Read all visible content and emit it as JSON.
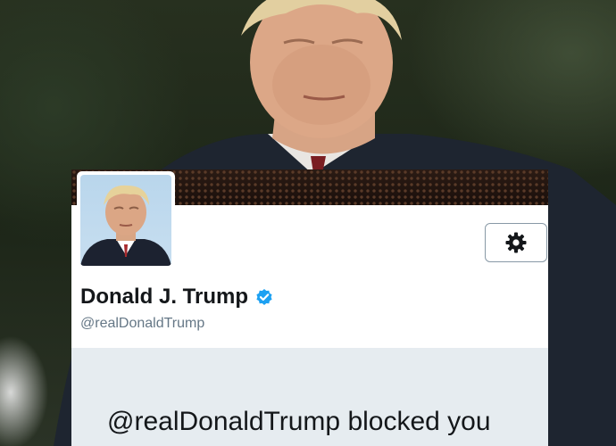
{
  "profile": {
    "display_name": "Donald J. Trump",
    "handle": "@realDonaldTrump",
    "verified": true,
    "verified_color": "#1da1f2"
  },
  "settings": {
    "icon": "gear-icon"
  },
  "blocked": {
    "message": "@realDonaldTrump blocked you"
  },
  "colors": {
    "card_background": "#ffffff",
    "blocked_panel_background": "#e6ecf0",
    "name_text": "#14171a",
    "handle_text": "#657786"
  }
}
